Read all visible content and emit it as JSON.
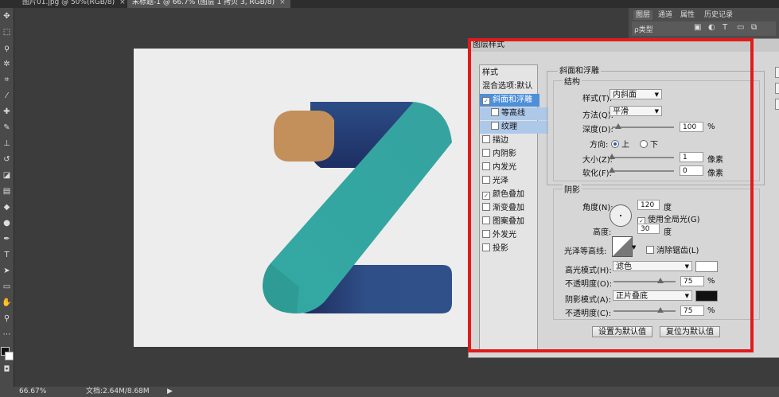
{
  "tabs": [
    {
      "label": "图片01.jpg @ 50%(RGB/8)",
      "close": "×",
      "active": false
    },
    {
      "label": "未标题-1 @ 66.7% (图层 1 拷贝 3, RGB/8)",
      "close": "×",
      "active": true
    }
  ],
  "status": {
    "zoom": "66.67%",
    "doc": "文档:2.64M/8.68M",
    "arrow": "▶"
  },
  "panel": {
    "tabs": [
      "图层",
      "通道",
      "属性",
      "历史记录"
    ],
    "filter": "ρ类型"
  },
  "dialog": {
    "title": "图层样式",
    "styles_header": "样式",
    "blend_options": "混合选项:默认",
    "items": [
      {
        "label": "斜面和浮雕",
        "checked": true,
        "state": "selected"
      },
      {
        "label": "等高线",
        "checked": false,
        "state": "sub"
      },
      {
        "label": "纹理",
        "checked": false,
        "state": "sub"
      },
      {
        "label": "描边",
        "checked": false,
        "state": ""
      },
      {
        "label": "内阴影",
        "checked": false,
        "state": ""
      },
      {
        "label": "内发光",
        "checked": false,
        "state": ""
      },
      {
        "label": "光泽",
        "checked": false,
        "state": ""
      },
      {
        "label": "颜色叠加",
        "checked": true,
        "state": ""
      },
      {
        "label": "渐变叠加",
        "checked": false,
        "state": ""
      },
      {
        "label": "图案叠加",
        "checked": false,
        "state": ""
      },
      {
        "label": "外发光",
        "checked": false,
        "state": ""
      },
      {
        "label": "投影",
        "checked": false,
        "state": ""
      }
    ],
    "bevel": {
      "section": "斜面和浮雕",
      "structure": "结构",
      "style_label": "样式(T):",
      "style_value": "内斜面",
      "method_label": "方法(Q):",
      "method_value": "平滑",
      "depth_label": "深度(D):",
      "depth_value": "100",
      "depth_unit": "%",
      "depth_level": 0.1,
      "direction_label": "方向:",
      "dir_up": "上",
      "dir_down": "下",
      "size_label": "大小(Z):",
      "size_value": "1",
      "size_unit": "像素",
      "size_level": 0.0,
      "soften_label": "软化(F):",
      "soften_value": "0",
      "soften_unit": "像素",
      "soften_level": 0.0
    },
    "shading": {
      "section": "阴影",
      "angle_label": "角度(N):",
      "angle_value": "120",
      "angle_unit": "度",
      "global_light": "使用全局光(G)",
      "global_checked": true,
      "altitude_label": "高度:",
      "altitude_value": "30",
      "altitude_unit": "度",
      "gloss_label": "光泽等高线:",
      "antialias": "消除锯齿(L)",
      "highlight_mode_label": "高光模式(H):",
      "highlight_mode": "滤色",
      "highlight_color": "#ffffff",
      "opacity1_label": "不透明度(O):",
      "opacity1_value": "75",
      "opacity1_unit": "%",
      "opacity1_level": 0.75,
      "shadow_mode_label": "阴影模式(A):",
      "shadow_mode": "正片叠底",
      "shadow_color": "#111111",
      "opacity2_label": "不透明度(C):",
      "opacity2_value": "75",
      "opacity2_unit": "%",
      "opacity2_level": 0.75
    },
    "buttons": {
      "set_default": "设置为默认值",
      "reset_default": "复位为默认值"
    }
  },
  "logo_colors": {
    "tan": "#c38f5b",
    "teal": "#35a39f",
    "navy": "#2f4f88"
  }
}
